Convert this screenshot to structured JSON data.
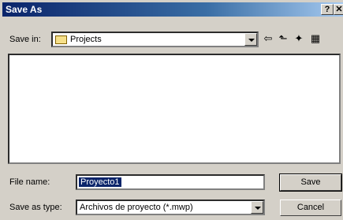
{
  "window": {
    "title": "Save As"
  },
  "toolbar": {
    "save_in_label": "Save in:",
    "save_in_value": "Projects"
  },
  "icons": {
    "help": "?",
    "close": "✕",
    "back": "⇦",
    "up": "⬑",
    "new_folder": "✦",
    "view": "▦"
  },
  "form": {
    "file_name_label": "File name:",
    "file_name_value": "Proyecto1",
    "save_as_type_label": "Save as type:",
    "save_as_type_value": "Archivos de proyecto (*.mwp)"
  },
  "buttons": {
    "save": "Save",
    "cancel": "Cancel"
  }
}
